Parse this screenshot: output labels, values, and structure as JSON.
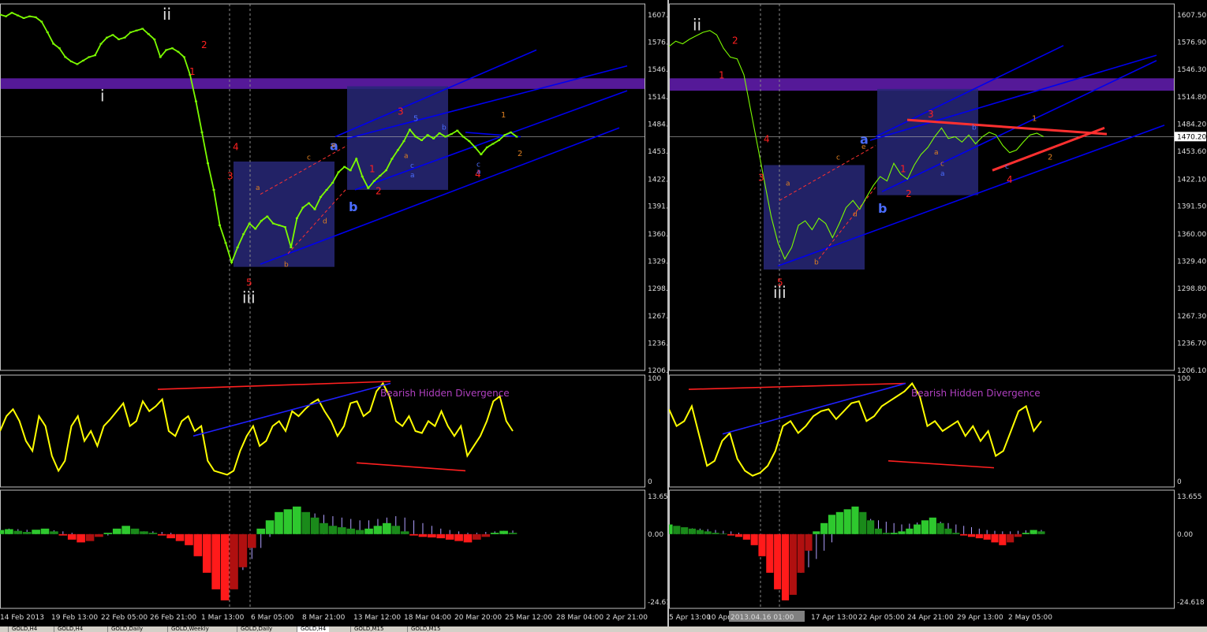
{
  "tabs": [
    "GOLD,H4",
    "GOLD,H4",
    "GOLD,Daily",
    "GOLD,Weekly",
    "GOLD,Daily",
    "GOLD,H4",
    "GOLD,M15",
    "GOLD,M15"
  ],
  "active_tab": 5,
  "colors": {
    "background": "#000000",
    "price_line": "#7cfc00",
    "resistance_zone": "#5a1aa0",
    "box": "#282878",
    "channel": "#0000ee",
    "oscillator": "#ffff00",
    "macd_positive": "#2ec82e",
    "macd_negative": "#ff1a1a",
    "macd_signal": "#b0a0ff",
    "divergence_high": "#ff2020",
    "divergence_low": "#2020ff",
    "divergence_text": "#b040c0"
  },
  "chart_data": [
    {
      "type": "line",
      "panel": "left",
      "symbol_timeframe": "GOLD,H4",
      "x_labels": [
        "14 Feb 2013",
        "19 Feb 13:00",
        "22 Feb 05:00",
        "26 Feb 21:00",
        "1 Mar 13:00",
        "6 Mar 05:00",
        "8 Mar 21:00",
        "13 Mar 12:00",
        "18 Mar 04:00",
        "20 Mar 20:00",
        "25 Mar 12:00",
        "28 Mar 04:00",
        "2 Apr 21:00"
      ],
      "price_ticks": [
        "1607.5",
        "1576.9",
        "1546.3",
        "1514.8",
        "1484.2",
        "1453.6",
        "1422.1",
        "1391.5",
        "1360.0",
        "1329.4",
        "1298.8",
        "1267.3",
        "1236.7",
        "1206.1"
      ],
      "current_price": "1470.2",
      "ylim": [
        1206.1,
        1620
      ],
      "price": [
        1608,
        1606,
        1610,
        1607,
        1604,
        1606,
        1605,
        1600,
        1588,
        1575,
        1570,
        1560,
        1555,
        1552,
        1556,
        1560,
        1562,
        1575,
        1582,
        1585,
        1580,
        1582,
        1588,
        1590,
        1592,
        1586,
        1580,
        1560,
        1568,
        1570,
        1566,
        1560,
        1540,
        1510,
        1475,
        1440,
        1410,
        1370,
        1350,
        1328,
        1345,
        1360,
        1372,
        1366,
        1375,
        1380,
        1372,
        1370,
        1368,
        1345,
        1378,
        1390,
        1395,
        1388,
        1402,
        1410,
        1418,
        1430,
        1436,
        1432,
        1445,
        1425,
        1412,
        1420,
        1426,
        1432,
        1445,
        1455,
        1465,
        1478,
        1470,
        1466,
        1472,
        1468,
        1474,
        1470,
        1473,
        1477,
        1470,
        1465,
        1458,
        1450,
        1458,
        1462,
        1466,
        1472,
        1475,
        1470
      ],
      "resistance_zone": [
        1524,
        1536
      ],
      "oscillator": {
        "ylim": [
          0,
          100
        ],
        "ticks": [
          "100",
          "0"
        ],
        "label": "Bearish Hidden Divergence",
        "values": [
          50,
          65,
          72,
          60,
          40,
          30,
          65,
          55,
          25,
          10,
          20,
          55,
          65,
          40,
          50,
          35,
          55,
          62,
          70,
          78,
          55,
          60,
          80,
          70,
          75,
          82,
          50,
          45,
          60,
          65,
          50,
          55,
          20,
          10,
          8,
          6,
          10,
          30,
          45,
          55,
          35,
          40,
          55,
          60,
          50,
          70,
          65,
          72,
          78,
          82,
          70,
          60,
          45,
          55,
          78,
          80,
          65,
          70,
          90,
          98,
          85,
          60,
          55,
          65,
          50,
          48,
          60,
          55,
          70,
          55,
          45,
          55,
          25,
          35,
          45,
          60,
          80,
          85,
          60,
          50
        ]
      },
      "macd": {
        "ticks": [
          "13.655",
          "0.00",
          "-24.618"
        ],
        "ylim": [
          -24.618,
          13.655
        ],
        "hist": [
          1.5,
          1.8,
          1.2,
          0.8,
          1.6,
          2.0,
          1.0,
          -0.5,
          -2.0,
          -3.0,
          -2.5,
          -1.0,
          0.5,
          2.0,
          3.0,
          2.0,
          1.0,
          0.5,
          -0.5,
          -1.5,
          -2.5,
          -4.0,
          -8.0,
          -14.0,
          -20.0,
          -24.0,
          -20.0,
          -12.0,
          -5.0,
          2.0,
          5.0,
          8.0,
          9.0,
          10.0,
          8.0,
          6.0,
          4.0,
          3.0,
          2.5,
          2.0,
          1.5,
          2.0,
          3.0,
          4.0,
          3.0,
          1.0,
          -0.5,
          -1.0,
          -1.2,
          -1.5,
          -2.0,
          -2.5,
          -3.0,
          -2.0,
          -1.0,
          0.5,
          1.2,
          0.5
        ],
        "signal": [
          2.0,
          2.0,
          1.8,
          1.6,
          1.5,
          1.5,
          1.4,
          1.0,
          0.5,
          0.0,
          -0.5,
          -0.8,
          -0.5,
          0.0,
          0.5,
          0.8,
          1.0,
          1.0,
          0.8,
          0.5,
          0.0,
          -1.0,
          -3.0,
          -6.0,
          -10.0,
          -14.0,
          -15.0,
          -13.0,
          -9.0,
          -5.0,
          -1.0,
          2.0,
          4.0,
          6.0,
          7.0,
          7.5,
          7.0,
          6.5,
          6.0,
          5.5,
          5.0,
          5.0,
          5.5,
          6.0,
          6.5,
          6.0,
          5.0,
          4.0,
          3.0,
          2.0,
          1.5,
          1.0,
          0.5,
          0.5,
          0.8,
          1.0,
          1.2,
          1.3
        ]
      },
      "wave_labels": [
        "i",
        "ii",
        "iii",
        "a",
        "b",
        "1",
        "2",
        "3",
        "4",
        "5"
      ]
    },
    {
      "type": "line",
      "panel": "right",
      "symbol_timeframe": "GOLD,Daily",
      "x_labels": [
        "5 Apr 13:00",
        "10 Apr",
        "2013.04.16 01:00",
        "17 Apr 13:00",
        "22 Apr 05:00",
        "24 Apr 21:00",
        "29 Apr 13:00",
        "2 May 05:00"
      ],
      "price_ticks": [
        "1607.50",
        "1576.90",
        "1546.30",
        "1514.80",
        "1484.20",
        "1470.20",
        "1453.60",
        "1422.10",
        "1391.50",
        "1360.00",
        "1329.40",
        "1298.80",
        "1267.30",
        "1236.70",
        "1206.10"
      ],
      "current_price": "1470.20",
      "ylim": [
        1206.1,
        1620
      ],
      "price": [
        1572,
        1578,
        1575,
        1580,
        1584,
        1588,
        1590,
        1585,
        1570,
        1560,
        1558,
        1540,
        1500,
        1460,
        1420,
        1380,
        1350,
        1332,
        1345,
        1370,
        1375,
        1365,
        1378,
        1372,
        1356,
        1372,
        1390,
        1398,
        1388,
        1402,
        1415,
        1425,
        1420,
        1440,
        1428,
        1422,
        1438,
        1450,
        1458,
        1470,
        1480,
        1468,
        1470,
        1464,
        1472,
        1462,
        1470,
        1475,
        1472,
        1460,
        1452,
        1455,
        1464,
        1472,
        1474,
        1470
      ],
      "resistance_zone": [
        1522,
        1536
      ],
      "oscillator": {
        "ylim": [
          0,
          100
        ],
        "ticks": [
          "100",
          "0"
        ],
        "label": "Bearish Hidden Divergence",
        "values": [
          72,
          55,
          60,
          75,
          45,
          15,
          20,
          40,
          48,
          22,
          10,
          5,
          8,
          15,
          30,
          55,
          60,
          48,
          55,
          65,
          70,
          72,
          62,
          70,
          78,
          80,
          60,
          65,
          75,
          80,
          85,
          90,
          98,
          85,
          55,
          60,
          50,
          55,
          60,
          45,
          55,
          40,
          50,
          25,
          30,
          50,
          70,
          75,
          50,
          60
        ]
      },
      "macd": {
        "ticks": [
          "13.655",
          "0.00",
          "-24.618"
        ],
        "ylim": [
          -24.618,
          13.655
        ],
        "hist": [
          3.5,
          3.0,
          2.5,
          2.0,
          1.5,
          1.0,
          0.5,
          0.2,
          -0.5,
          -1.0,
          -2.0,
          -4.0,
          -8.0,
          -14.0,
          -20.0,
          -24.0,
          -22.0,
          -14.0,
          -6.0,
          1.0,
          4.0,
          7.0,
          8.0,
          9.0,
          10.0,
          8.0,
          5.0,
          2.0,
          0.5,
          0.5,
          1.0,
          2.0,
          3.5,
          5.0,
          6.0,
          4.0,
          2.0,
          0.5,
          -0.5,
          -1.0,
          -1.5,
          -2.0,
          -3.0,
          -4.0,
          -3.0,
          -1.0,
          0.5,
          1.5,
          1.0
        ],
        "signal": [
          2.5,
          2.4,
          2.3,
          2.1,
          2.0,
          1.8,
          1.5,
          1.2,
          1.0,
          0.5,
          0.0,
          -1.0,
          -3.0,
          -6.0,
          -10.0,
          -13.0,
          -15.0,
          -14.0,
          -12.0,
          -9.0,
          -6.0,
          -3.0,
          0.0,
          2.0,
          4.0,
          5.0,
          5.5,
          5.0,
          4.5,
          4.0,
          3.5,
          3.8,
          4.2,
          4.5,
          4.8,
          4.5,
          4.0,
          3.5,
          3.0,
          2.5,
          2.0,
          1.5,
          1.2,
          1.0,
          1.0,
          1.2,
          1.4,
          1.5,
          1.5
        ]
      },
      "wave_labels": [
        "ii",
        "iii",
        "a",
        "b",
        "1",
        "2",
        "3",
        "4"
      ]
    }
  ]
}
